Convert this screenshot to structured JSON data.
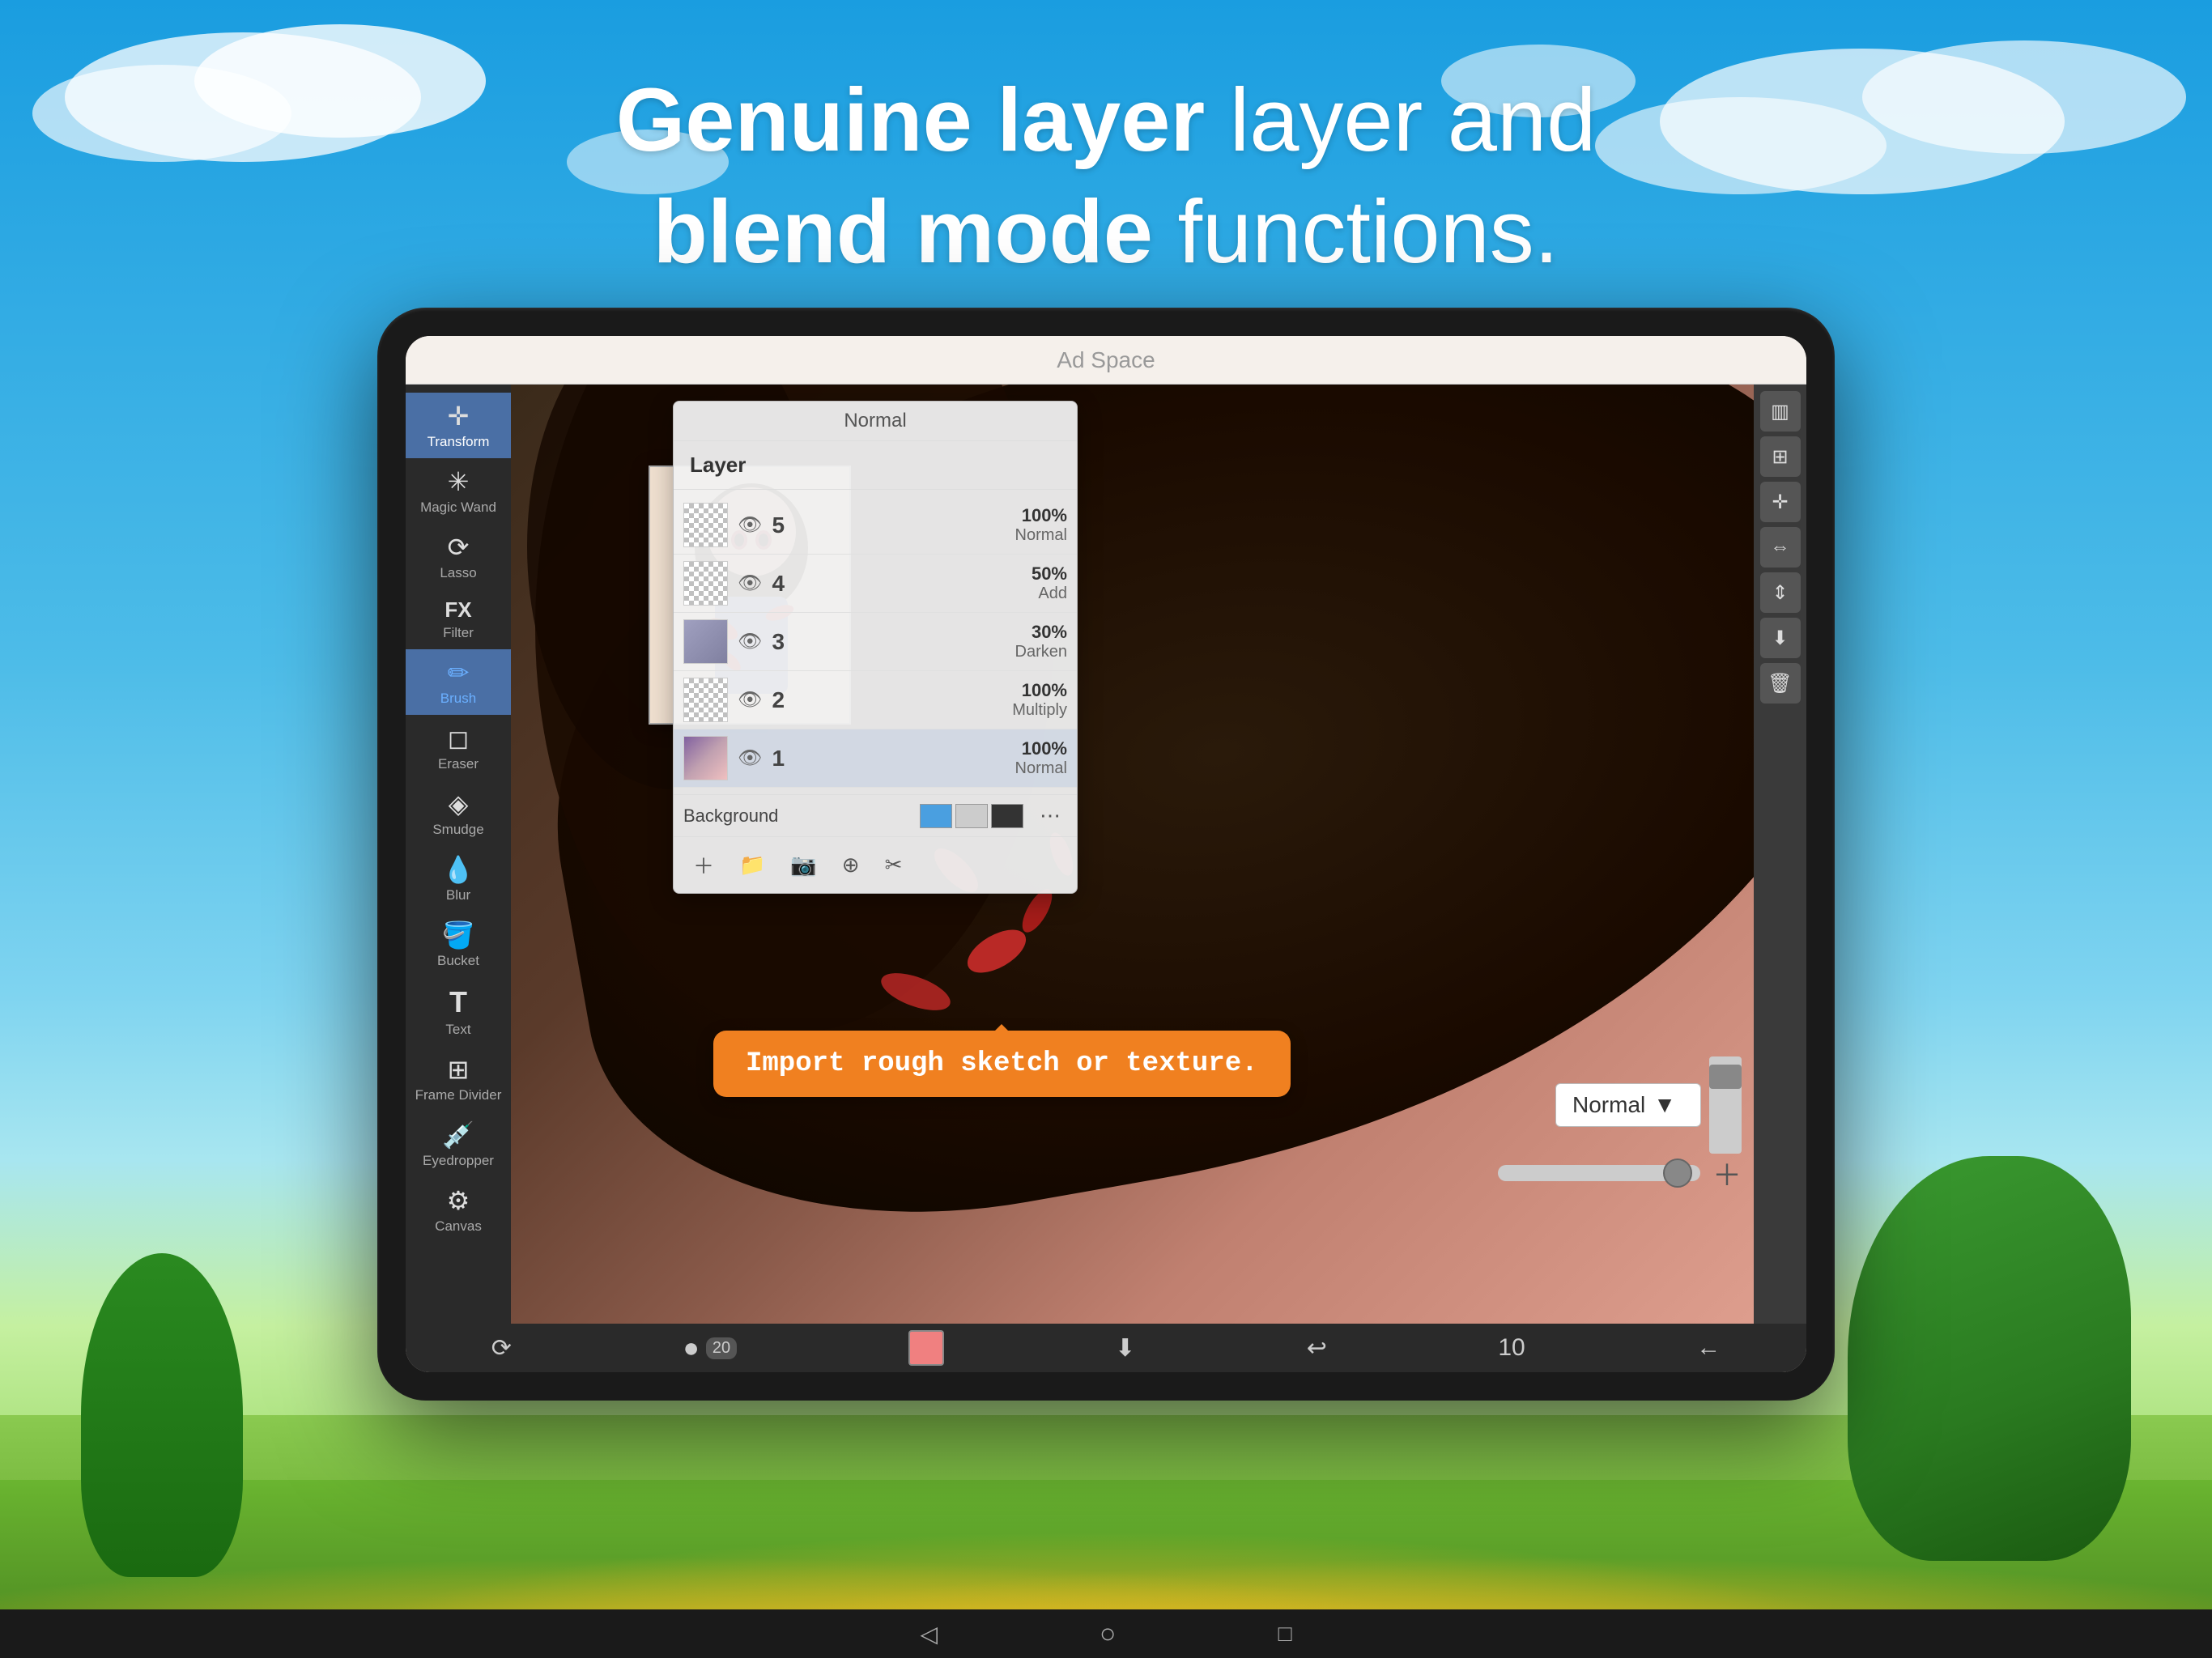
{
  "background": {
    "sky_color_top": "#1a9de0",
    "sky_color_mid": "#4dbce8",
    "sky_color_bottom": "#7fd4f0"
  },
  "headline": {
    "line1_regular": "layer and",
    "line1_bold": "Genuine layer",
    "line2_bold": "blend mode",
    "line2_regular": "functions."
  },
  "ad_bar": {
    "text": "Ad Space"
  },
  "toolbar": {
    "tools": [
      {
        "label": "Transform",
        "icon": "✛"
      },
      {
        "label": "Magic Wand",
        "icon": "✳"
      },
      {
        "label": "Lasso",
        "icon": "⟳"
      },
      {
        "label": "Filter",
        "icon": "FX"
      },
      {
        "label": "Brush",
        "icon": "/"
      },
      {
        "label": "Eraser",
        "icon": "◻"
      },
      {
        "label": "Smudge",
        "icon": "◈"
      },
      {
        "label": "Blur",
        "icon": "💧"
      },
      {
        "label": "Bucket",
        "icon": "🪣"
      },
      {
        "label": "Text",
        "icon": "T"
      },
      {
        "label": "Frame Divider",
        "icon": "⊞"
      },
      {
        "label": "Eyedropper",
        "icon": "💉"
      },
      {
        "label": "Canvas",
        "icon": "⚙"
      }
    ]
  },
  "layer_panel": {
    "title": "Layer",
    "blend_mode_top": "Normal",
    "layers": [
      {
        "num": "5",
        "opacity": "100%",
        "blend": "Normal",
        "has_content": true
      },
      {
        "num": "4",
        "opacity": "50%",
        "blend": "Add",
        "has_content": false
      },
      {
        "num": "3",
        "opacity": "30%",
        "blend": "Darken",
        "has_content": true
      },
      {
        "num": "2",
        "opacity": "100%",
        "blend": "Multiply",
        "has_content": false
      },
      {
        "num": "1",
        "opacity": "100%",
        "blend": "Normal",
        "has_content": true
      }
    ],
    "background_label": "Background",
    "bottom_buttons": [
      "+",
      "+",
      "📷",
      "⊕",
      "✂"
    ]
  },
  "blend_mode_bar": {
    "label": "Normal"
  },
  "tooltip": {
    "text": "Import rough sketch or texture."
  },
  "bottom_toolbar": {
    "buttons": [
      "⟳",
      "🔄",
      "📷",
      "⊕",
      "✂"
    ],
    "brush_size": "20",
    "color": "#f08080",
    "download_icon": "⬇",
    "undo_icon": "↩",
    "page_num": "10",
    "back_icon": "←"
  },
  "android_nav": {
    "back": "◁",
    "home": "○",
    "recent": "□"
  }
}
